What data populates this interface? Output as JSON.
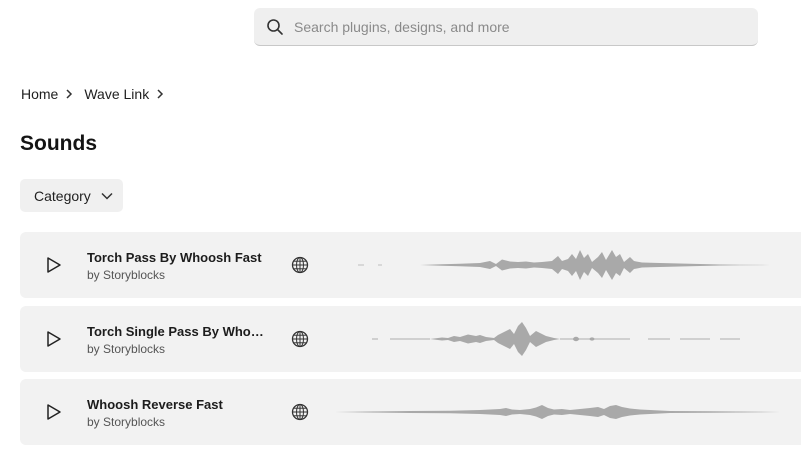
{
  "search": {
    "placeholder": "Search plugins, designs, and more"
  },
  "breadcrumb": [
    {
      "label": "Home"
    },
    {
      "label": "Wave Link"
    }
  ],
  "page": {
    "title": "Sounds"
  },
  "filter": {
    "label": "Category"
  },
  "sounds": [
    {
      "title": "Torch Pass By Whoosh Fast",
      "author": "by Storyblocks"
    },
    {
      "title": "Torch Single Pass By Whoosh",
      "author": "by Storyblocks"
    },
    {
      "title": "Whoosh Reverse Fast",
      "author": "by Storyblocks"
    }
  ],
  "colors": {
    "row_bg": "#f2f2f2",
    "waveform": "#a9a9a9",
    "search_bg": "#efefef"
  }
}
